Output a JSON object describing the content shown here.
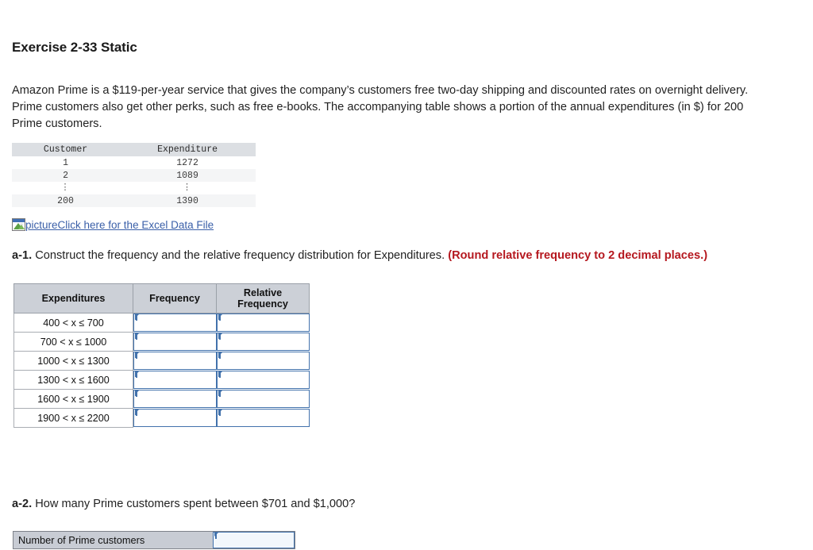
{
  "exercise": {
    "title": "Exercise 2-33 Static",
    "intro": "Amazon Prime is a $119-per-year service that gives the company’s customers free two-day shipping and discounted rates on overnight delivery. Prime customers also get other perks, such as free e-books. The accompanying table shows a portion of the annual expenditures (in $) for 200 Prime customers."
  },
  "preview_table": {
    "headers": [
      "Customer",
      "Expenditure"
    ],
    "rows": [
      [
        "1",
        "1272"
      ],
      [
        "2",
        "1089"
      ],
      [
        "⋮",
        "⋮"
      ],
      [
        "200",
        "1390"
      ]
    ]
  },
  "excel_link": {
    "icon_alt": "picture",
    "text": "Click here for the Excel Data File"
  },
  "questions": {
    "a1": {
      "label": "a-1.",
      "text": "Construct the frequency and the relative frequency distribution for Expenditures.",
      "note": "(Round relative frequency to 2 decimal places.)"
    },
    "a2": {
      "label": "a-2.",
      "text": "How many Prime customers spent between $701 and $1,000?"
    }
  },
  "frequency_table": {
    "headers": [
      "Expenditures",
      "Frequency",
      "Relative Frequency"
    ],
    "rows": [
      {
        "bin": "400 < x ≤ 700",
        "frequency": "",
        "relative_frequency": ""
      },
      {
        "bin": "700 < x ≤ 1000",
        "frequency": "",
        "relative_frequency": ""
      },
      {
        "bin": "1000 < x ≤ 1300",
        "frequency": "",
        "relative_frequency": ""
      },
      {
        "bin": "1300 < x ≤ 1600",
        "frequency": "",
        "relative_frequency": ""
      },
      {
        "bin": "1600 < x ≤ 1900",
        "frequency": "",
        "relative_frequency": ""
      },
      {
        "bin": "1900 < x ≤ 2200",
        "frequency": "",
        "relative_frequency": ""
      }
    ]
  },
  "a2_answer": {
    "label": "Number of Prime customers",
    "value": "",
    "placeholder": ""
  },
  "colors": {
    "accent_blue": "#4272ac",
    "link_blue": "#3a5fa8",
    "note_red": "#b5181f",
    "header_gray": "#ccd0d7",
    "preview_header_gray": "#dcdfe3",
    "label_cell_gray": "#c8ccd4"
  }
}
